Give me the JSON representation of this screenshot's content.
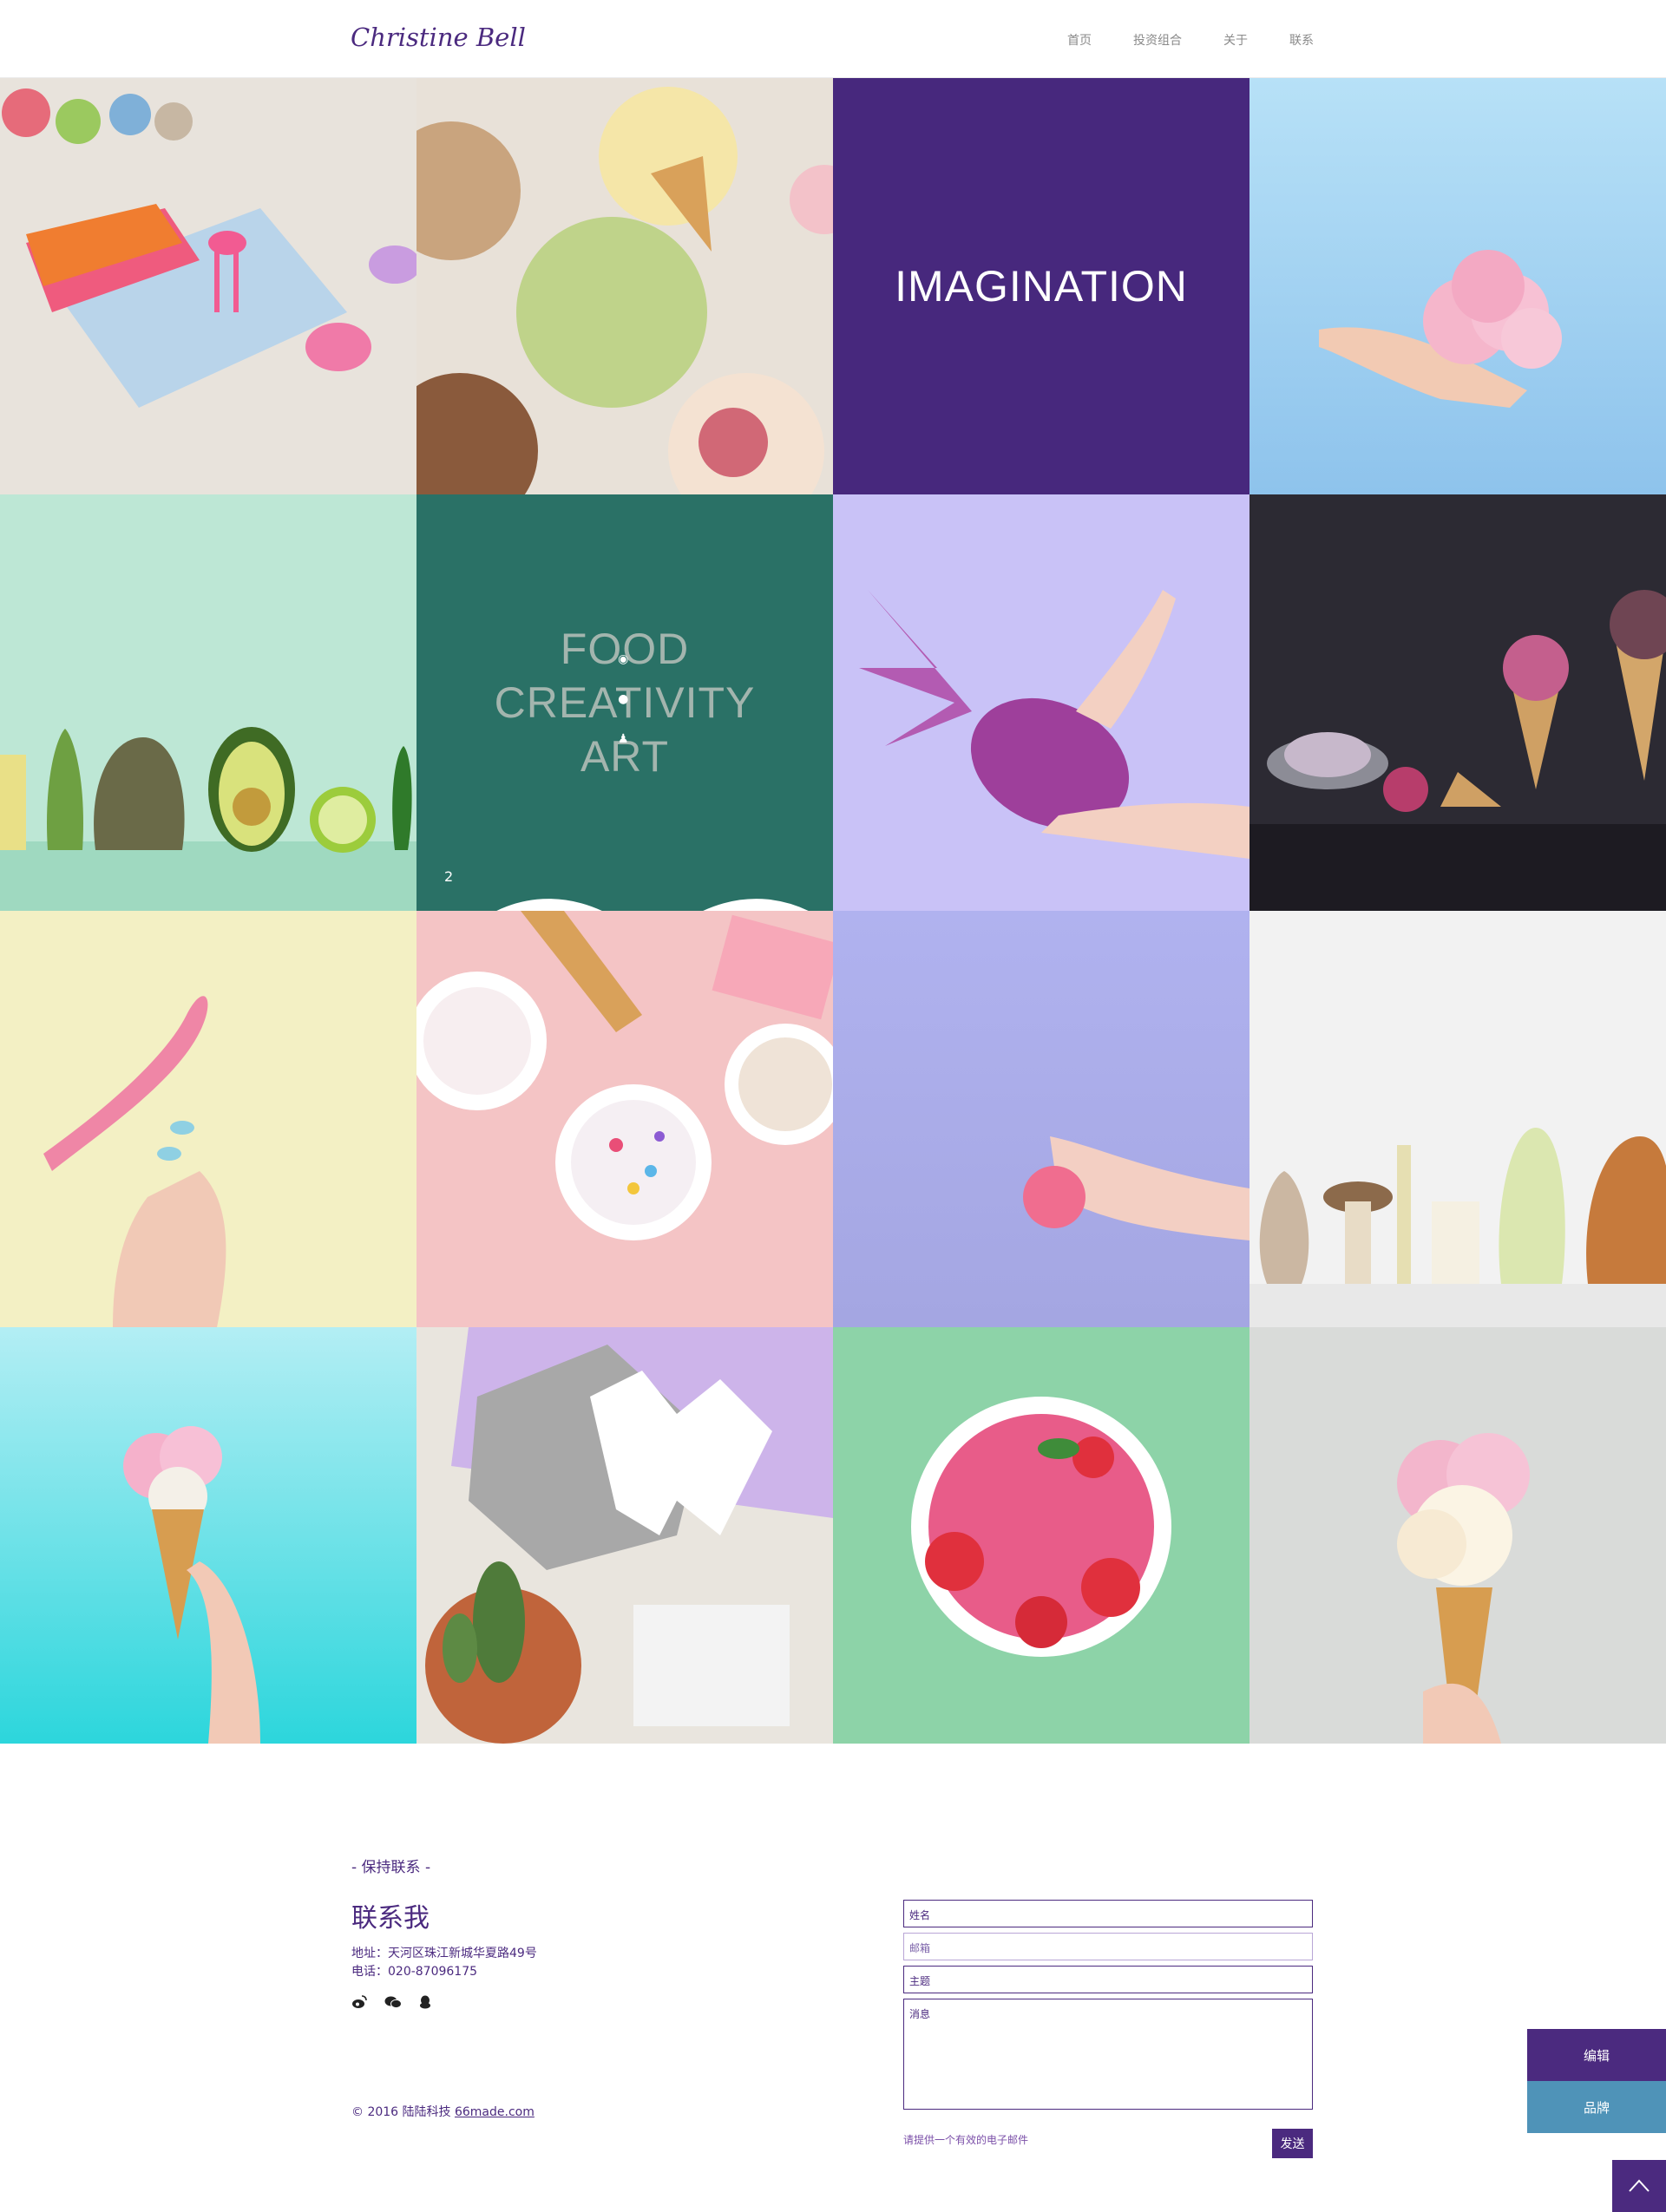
{
  "header": {
    "logo": "Christine Bell",
    "nav": [
      "首页",
      "投资组合",
      "关于",
      "联系"
    ]
  },
  "tiles": {
    "imagination": "IMAGINATION",
    "food_lines": [
      "FOOD",
      "CREATIVITY",
      "ART"
    ],
    "like_count": "2"
  },
  "colors": {
    "accent": "#4b2a7f",
    "teal_tile": "#2a7166",
    "brand_button": "#4f93b8"
  },
  "contact": {
    "kicker": "- 保持联系 -",
    "title": "联系我",
    "address": "地址：天河区珠江新城华夏路49号",
    "phone": "电话：020-87096175",
    "copyright_prefix": "© 2016 陆陆科技 ",
    "copyright_link": "66made.com",
    "social_icons": [
      "weibo-icon",
      "wechat-icon",
      "qq-icon"
    ]
  },
  "form": {
    "name_placeholder": "姓名",
    "email_placeholder": "邮箱",
    "subject_placeholder": "主题",
    "message_placeholder": "消息",
    "hint": "请提供一个有效的电子邮件",
    "send_label": "发送"
  },
  "floating": {
    "edit_label": "编辑",
    "brand_label": "品牌"
  }
}
